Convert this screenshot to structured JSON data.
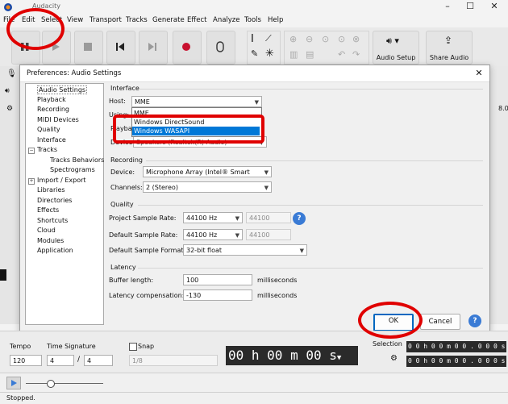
{
  "app": {
    "title": "Audacity"
  },
  "menu": [
    "File",
    "Edit",
    "Select",
    "View",
    "Transport",
    "Tracks",
    "Generate",
    "Effect",
    "Analyze",
    "Tools",
    "Help"
  ],
  "toolbar": {
    "audio_setup_label": "Audio Setup",
    "share_audio_label": "Share Audio"
  },
  "ruler": {
    "right_value": "8.0"
  },
  "dialog": {
    "title": "Preferences: Audio Settings",
    "tree": [
      {
        "label": "Audio Settings",
        "level": 0,
        "selected": true
      },
      {
        "label": "Playback",
        "level": 0
      },
      {
        "label": "Recording",
        "level": 0
      },
      {
        "label": "MIDI Devices",
        "level": 0
      },
      {
        "label": "Quality",
        "level": 0
      },
      {
        "label": "Interface",
        "level": 0
      },
      {
        "label": "Tracks",
        "level": 0,
        "expander": "−"
      },
      {
        "label": "Tracks Behaviors",
        "level": 1
      },
      {
        "label": "Spectrograms",
        "level": 1
      },
      {
        "label": "Import / Export",
        "level": 0,
        "expander": "+"
      },
      {
        "label": "Libraries",
        "level": 0
      },
      {
        "label": "Directories",
        "level": 0
      },
      {
        "label": "Effects",
        "level": 0
      },
      {
        "label": "Shortcuts",
        "level": 0
      },
      {
        "label": "Cloud",
        "level": 0
      },
      {
        "label": "Modules",
        "level": 0
      },
      {
        "label": "Application",
        "level": 0
      }
    ],
    "interface": {
      "section": "Interface",
      "host_label": "Host:",
      "host_value": "MME",
      "host_options": [
        "MME",
        "Windows DirectSound",
        "Windows WASAPI"
      ],
      "host_highlight": "Windows WASAPI",
      "using_label": "Using:",
      "playback_label": "Playba",
      "device_label": "Device:",
      "device_value": "Speakers (Realtek(R) Audio)"
    },
    "recording": {
      "section": "Recording",
      "device_label": "Device:",
      "device_value": "Microphone Array (Intel® Smart",
      "channels_label": "Channels:",
      "channels_value": "2 (Stereo)"
    },
    "quality": {
      "section": "Quality",
      "project_rate_label": "Project Sample Rate:",
      "project_rate_value": "44100 Hz",
      "project_rate_other": "44100",
      "default_rate_label": "Default Sample Rate:",
      "default_rate_value": "44100 Hz",
      "default_rate_other": "44100",
      "format_label": "Default Sample Format:",
      "format_value": "32-bit float",
      "help_glyph": "?"
    },
    "latency": {
      "section": "Latency",
      "buffer_label": "Buffer length:",
      "buffer_value": "100",
      "buffer_unit": "milliseconds",
      "comp_label": "Latency compensation:",
      "comp_value": "-130",
      "comp_unit": "milliseconds"
    },
    "buttons": {
      "ok": "OK",
      "cancel": "Cancel",
      "help": "?"
    }
  },
  "bottom": {
    "tempo_label": "Tempo",
    "tempo_value": "120",
    "time_sig_label": "Time Signature",
    "time_sig_num": "4",
    "time_sig_sep": "/",
    "time_sig_den": "4",
    "snap_label": "Snap",
    "snap_value": "1/8",
    "time_display": "00 h 00 m 00 s",
    "selection_label": "Selection",
    "selection_start": "0 0 h 0 0 m 0 0 . 0 0 0 s",
    "selection_end": "0 0 h 0 0 m 0 0 . 0 0 0 s"
  },
  "status": {
    "text": "Stopped."
  },
  "colors": {
    "highlight": "#0078d7",
    "annotation": "#e00000",
    "ok_border": "#0067c0"
  }
}
